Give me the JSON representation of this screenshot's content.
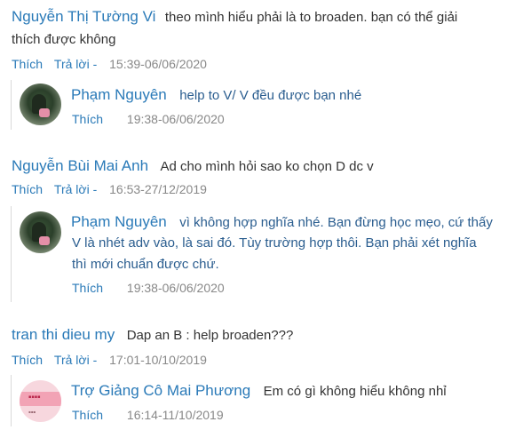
{
  "comments": [
    {
      "author": "Nguyễn Thị Tường Vi",
      "text_lines": [
        "theo mình hiểu phải là to broaden. bạn có thể giải",
        "thích được không"
      ],
      "like_label": "Thích",
      "reply_label": "Trả lời -",
      "timestamp": "15:39-06/06/2020",
      "reply": {
        "author": "Phạm Nguyên",
        "text_lines": [
          "help to V/ V đều được bạn nhé"
        ],
        "like_label": "Thích",
        "timestamp": "19:38-06/06/2020",
        "avatar": "profile-photo-green"
      }
    },
    {
      "author": "Nguyễn Bùi Mai Anh",
      "text_lines": [
        "Ad cho mình hỏi sao ko chọn D dc v"
      ],
      "like_label": "Thích",
      "reply_label": "Trả lời -",
      "timestamp": "16:53-27/12/2019",
      "reply": {
        "author": "Phạm Nguyên",
        "text_lines": [
          "vì không hợp nghĩa nhé. Bạn đừng học mẹo, cứ thấy",
          "V là nhét adv vào, là sai đó. Tùy trường hợp thôi. Bạn phải xét nghĩa",
          "thì mới chuẩn được chứ."
        ],
        "like_label": "Thích",
        "timestamp": "19:38-06/06/2020",
        "avatar": "profile-photo-green"
      }
    },
    {
      "author": "tran thi dieu my",
      "text_lines": [
        "Dap an B : help broaden???"
      ],
      "like_label": "Thích",
      "reply_label": "Trả lời -",
      "timestamp": "17:01-10/10/2019",
      "reply": {
        "author": "Trợ Giảng Cô Mai Phương",
        "text_lines": [
          "Em có gì không hiểu không nhỉ"
        ],
        "like_label": "Thích",
        "timestamp": "16:14-11/10/2019",
        "avatar": "profile-photo-pink"
      }
    }
  ],
  "colors": {
    "author": "#2a7ab8",
    "text": "#333333",
    "meta": "#888888",
    "divider": "#d9d9d9"
  }
}
